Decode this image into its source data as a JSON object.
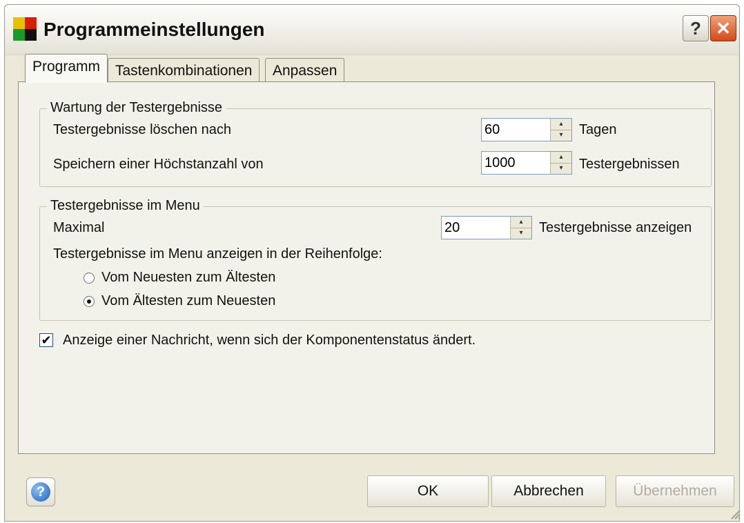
{
  "window": {
    "title": "Programmeinstellungen",
    "help_glyph": "?",
    "close_glyph": "✕",
    "icon": "app-logo-icon"
  },
  "tabs": [
    {
      "label": "Programm",
      "active": true
    },
    {
      "label": "Tastenkombinationen",
      "active": false
    },
    {
      "label": "Anpassen",
      "active": false
    }
  ],
  "maintenance": {
    "legend": "Wartung der Testergebnisse",
    "delete_label": "Testergebnisse löschen nach",
    "delete_value": "60",
    "delete_unit": "Tagen",
    "max_store_label": "Speichern einer Höchstanzahl von",
    "max_store_value": "1000",
    "max_store_unit": "Testergebnissen"
  },
  "menu_results": {
    "legend": "Testergebnisse im Menu",
    "max_label": "Maximal",
    "max_value": "20",
    "max_unit": "Testergebnisse anzeigen",
    "order_label": "Testergebnisse im Menu anzeigen in der Reihenfolge:",
    "order_options": [
      {
        "label": "Vom Neuesten zum Ältesten",
        "checked": false
      },
      {
        "label": "Vom Ältesten zum Neuesten",
        "checked": true
      }
    ]
  },
  "notify": {
    "label": "Anzeige einer Nachricht, wenn sich der Komponentenstatus ändert.",
    "checked": true,
    "check_glyph": "✔"
  },
  "buttons": {
    "help_glyph": "?",
    "ok": "OK",
    "cancel": "Abbrechen",
    "apply": "Übernehmen"
  },
  "spin_glyphs": {
    "up": "▴",
    "down": "▾"
  }
}
